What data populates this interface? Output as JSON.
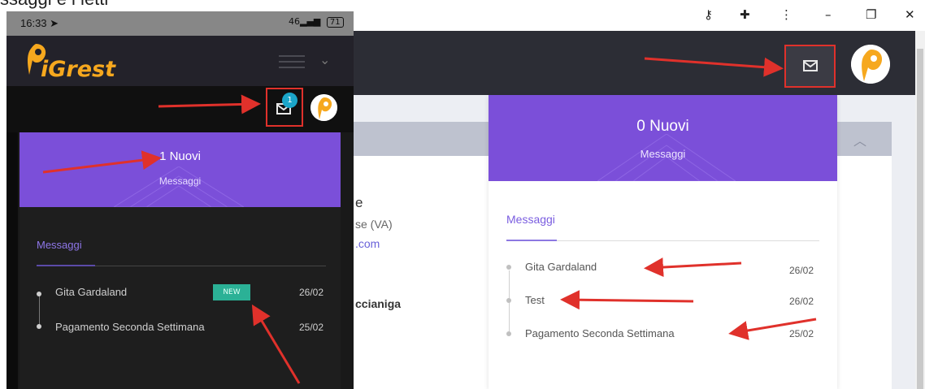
{
  "caption": "ssaggi e i letti",
  "phone": {
    "status_time": "16:33",
    "status_signal": "46",
    "status_battery": "71",
    "logo": "iGrest",
    "badge": "1",
    "new_count": "1 Nuovi",
    "sub": "Messaggi",
    "tab": "Messaggi",
    "new_tag": "NEW",
    "messages": [
      {
        "title": "Gita Gardaland",
        "date": "26/02"
      },
      {
        "title": "Pagamento Seconda Settimana",
        "date": "25/02"
      }
    ]
  },
  "browser": {
    "partial": {
      "line1": "e",
      "line2": "se (VA)",
      "line3": ".com",
      "line4": "ccianiga"
    },
    "dropdown": {
      "new_count": "0 Nuovi",
      "sub": "Messaggi",
      "tab": "Messaggi",
      "messages": [
        {
          "title": "Gita Gardaland",
          "date": "26/02"
        },
        {
          "title": "Test",
          "date": "26/02"
        },
        {
          "title": "Pagamento Seconda Settimana",
          "date": "25/02"
        }
      ]
    }
  },
  "colors": {
    "brand_purple": "#7b4fd9",
    "brand_orange": "#f6a81e",
    "annotation_red": "#e0312b",
    "new_tag_green": "#2bb196",
    "badge_blue": "#1ba6c9"
  }
}
